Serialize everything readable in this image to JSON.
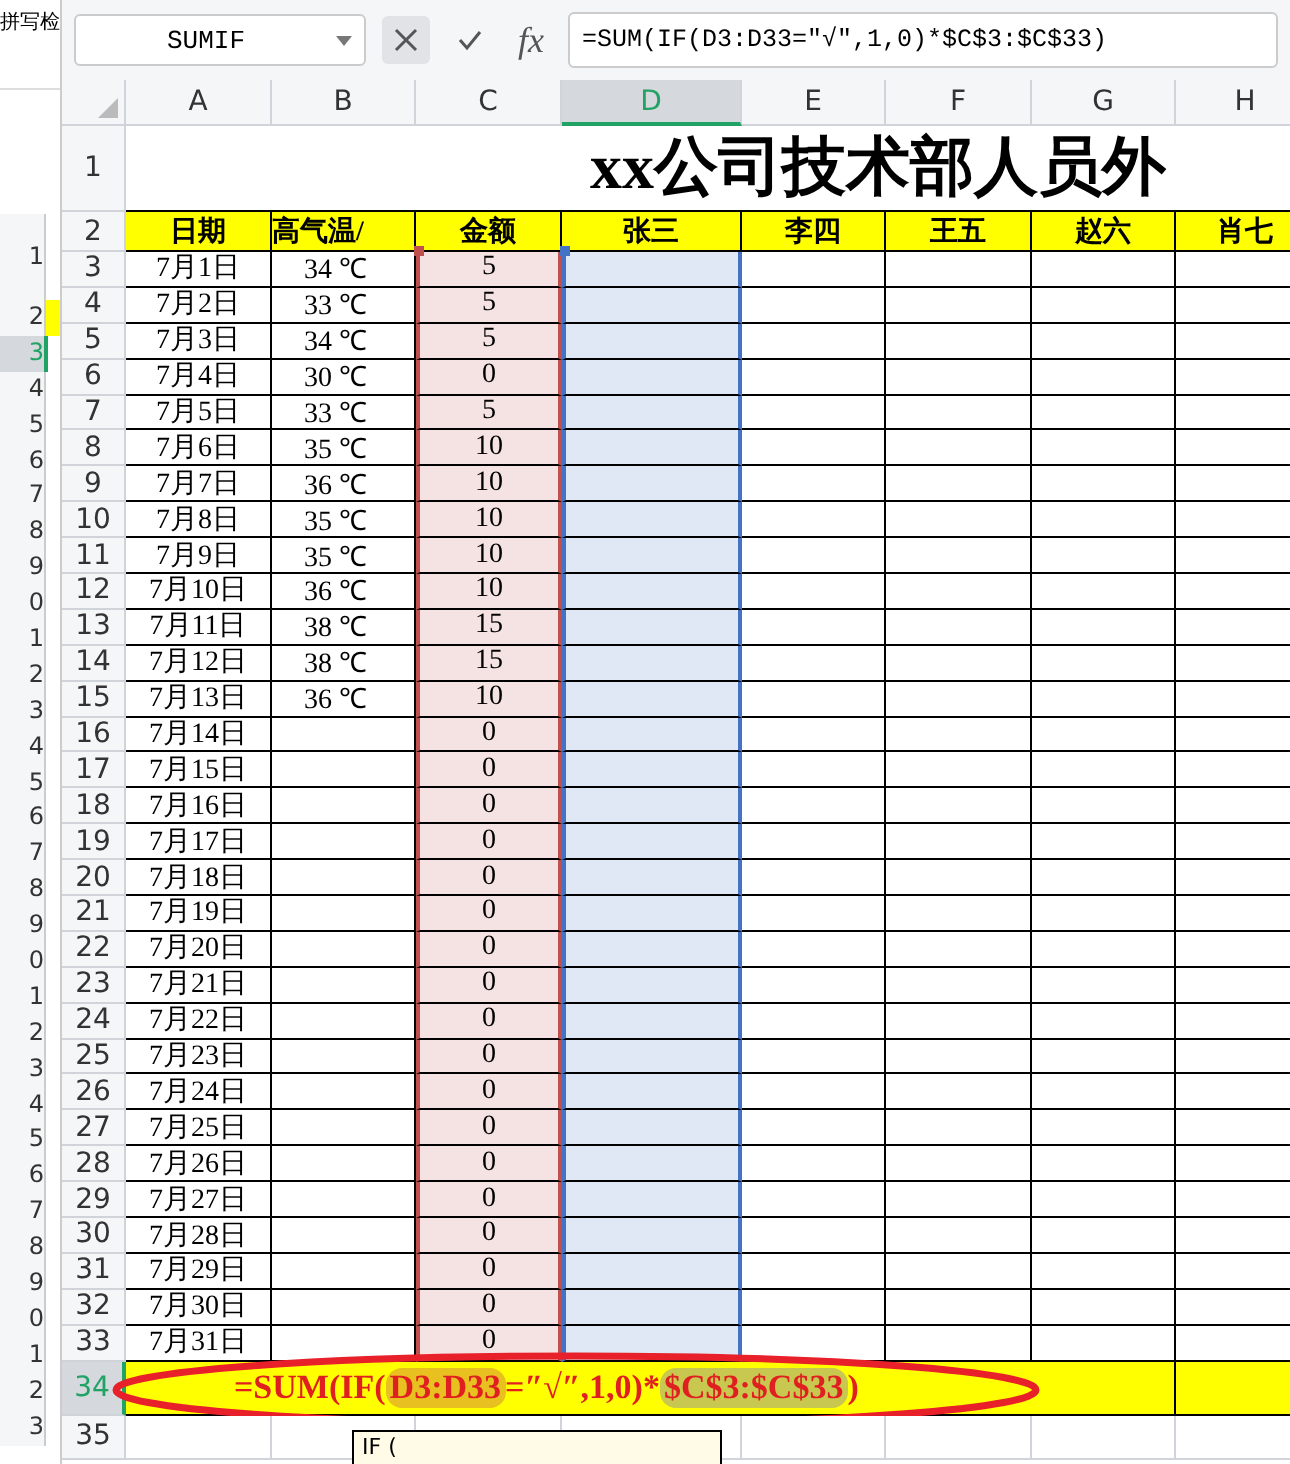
{
  "background_window": {
    "toolbar_text": "拼写检",
    "rows": [
      {
        "label": "1",
        "selected": false,
        "filled": false
      },
      {
        "label": "2",
        "selected": false,
        "filled": true
      },
      {
        "label": "3",
        "selected": true,
        "filled": false
      },
      {
        "label": "4",
        "selected": false,
        "filled": false
      },
      {
        "label": "5",
        "selected": false,
        "filled": false
      },
      {
        "label": "6",
        "selected": false,
        "filled": false
      },
      {
        "label": "7",
        "selected": false,
        "filled": false
      },
      {
        "label": "8",
        "selected": false,
        "filled": false
      },
      {
        "label": "9",
        "selected": false,
        "filled": false
      },
      {
        "label": "0",
        "selected": false,
        "filled": false
      },
      {
        "label": "1",
        "selected": false,
        "filled": false
      },
      {
        "label": "2",
        "selected": false,
        "filled": false
      },
      {
        "label": "3",
        "selected": false,
        "filled": false
      },
      {
        "label": "4",
        "selected": false,
        "filled": false
      },
      {
        "label": "5",
        "selected": false,
        "filled": false
      },
      {
        "label": "6",
        "selected": false,
        "filled": false
      },
      {
        "label": "7",
        "selected": false,
        "filled": false
      },
      {
        "label": "8",
        "selected": false,
        "filled": false
      },
      {
        "label": "9",
        "selected": false,
        "filled": false
      },
      {
        "label": "0",
        "selected": false,
        "filled": false
      },
      {
        "label": "1",
        "selected": false,
        "filled": false
      },
      {
        "label": "2",
        "selected": false,
        "filled": false
      },
      {
        "label": "3",
        "selected": false,
        "filled": false
      },
      {
        "label": "4",
        "selected": false,
        "filled": false
      },
      {
        "label": "5",
        "selected": false,
        "filled": false
      },
      {
        "label": "6",
        "selected": false,
        "filled": false
      },
      {
        "label": "7",
        "selected": false,
        "filled": false
      },
      {
        "label": "8",
        "selected": false,
        "filled": false
      },
      {
        "label": "9",
        "selected": false,
        "filled": false
      },
      {
        "label": "0",
        "selected": false,
        "filled": false
      },
      {
        "label": "1",
        "selected": false,
        "filled": false
      },
      {
        "label": "2",
        "selected": false,
        "filled": false
      },
      {
        "label": "3",
        "selected": false,
        "filled": false
      }
    ]
  },
  "formula_bar": {
    "name_box": "SUMIF",
    "fx": "fx",
    "formula": "=SUM(IF(D3:D33=″√″,1,0)*$C$3:$C$33)"
  },
  "columns": [
    {
      "label": "A",
      "selected": false
    },
    {
      "label": "B",
      "selected": false
    },
    {
      "label": "C",
      "selected": false,
      "color": "#c0504d"
    },
    {
      "label": "D",
      "selected": true,
      "color": "#4472c4"
    },
    {
      "label": "E",
      "selected": false
    },
    {
      "label": "F",
      "selected": false
    },
    {
      "label": "G",
      "selected": false
    },
    {
      "label": "H",
      "selected": false
    }
  ],
  "title_row": {
    "number": "1",
    "title": "xx公司技术部人员外"
  },
  "header_row": {
    "number": "2",
    "cells": [
      "日期",
      "高气温/",
      "金额",
      "张三",
      "李四",
      "王五",
      "赵六",
      "肖七"
    ]
  },
  "data_rows": [
    {
      "number": "3",
      "date": "7月1日",
      "temp": "34 ℃",
      "amount": "5"
    },
    {
      "number": "4",
      "date": "7月2日",
      "temp": "33 ℃",
      "amount": "5"
    },
    {
      "number": "5",
      "date": "7月3日",
      "temp": "34 ℃",
      "amount": "5"
    },
    {
      "number": "6",
      "date": "7月4日",
      "temp": "30 ℃",
      "amount": "0"
    },
    {
      "number": "7",
      "date": "7月5日",
      "temp": "33 ℃",
      "amount": "5"
    },
    {
      "number": "8",
      "date": "7月6日",
      "temp": "35 ℃",
      "amount": "10"
    },
    {
      "number": "9",
      "date": "7月7日",
      "temp": "36 ℃",
      "amount": "10"
    },
    {
      "number": "10",
      "date": "7月8日",
      "temp": "35 ℃",
      "amount": "10"
    },
    {
      "number": "11",
      "date": "7月9日",
      "temp": "35 ℃",
      "amount": "10"
    },
    {
      "number": "12",
      "date": "7月10日",
      "temp": "36 ℃",
      "amount": "10"
    },
    {
      "number": "13",
      "date": "7月11日",
      "temp": "38 ℃",
      "amount": "15"
    },
    {
      "number": "14",
      "date": "7月12日",
      "temp": "38 ℃",
      "amount": "15"
    },
    {
      "number": "15",
      "date": "7月13日",
      "temp": "36 ℃",
      "amount": "10"
    },
    {
      "number": "16",
      "date": "7月14日",
      "amount": "0"
    },
    {
      "number": "17",
      "date": "7月15日",
      "amount": "0"
    },
    {
      "number": "18",
      "date": "7月16日",
      "amount": "0"
    },
    {
      "number": "19",
      "date": "7月17日",
      "amount": "0"
    },
    {
      "number": "20",
      "date": "7月18日",
      "amount": "0"
    },
    {
      "number": "21",
      "date": "7月19日",
      "amount": "0"
    },
    {
      "number": "22",
      "date": "7月20日",
      "amount": "0"
    },
    {
      "number": "23",
      "date": "7月21日",
      "amount": "0"
    },
    {
      "number": "24",
      "date": "7月22日",
      "amount": "0"
    },
    {
      "number": "25",
      "date": "7月23日",
      "amount": "0"
    },
    {
      "number": "26",
      "date": "7月24日",
      "amount": "0"
    },
    {
      "number": "27",
      "date": "7月25日",
      "amount": "0"
    },
    {
      "number": "28",
      "date": "7月26日",
      "amount": "0"
    },
    {
      "number": "29",
      "date": "7月27日",
      "amount": "0"
    },
    {
      "number": "30",
      "date": "7月28日",
      "amount": "0"
    },
    {
      "number": "31",
      "date": "7月29日",
      "amount": "0"
    },
    {
      "number": "32",
      "date": "7月30日",
      "amount": "0"
    },
    {
      "number": "33",
      "date": "7月31日",
      "amount": "0"
    }
  ],
  "total_row": {
    "number": "34",
    "selected": true,
    "segments": [
      {
        "text": "=SUM(IF(",
        "kind": "plain"
      },
      {
        "text": "D3:D33",
        "kind": "ref"
      },
      {
        "text": "=″√″,1,0)*",
        "kind": "plain"
      },
      {
        "text": "$C$3:$C$33",
        "kind": "ref"
      },
      {
        "text": ")",
        "kind": "plain"
      }
    ]
  },
  "last_row": {
    "number": "35"
  },
  "tooltip": {
    "text": "IF ("
  }
}
